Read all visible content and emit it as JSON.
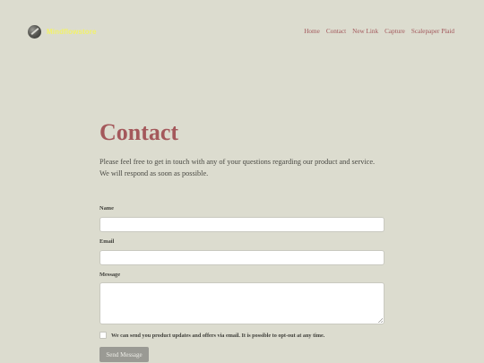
{
  "header": {
    "logo_text": "Mindflowstore",
    "nav": [
      {
        "label": "Home"
      },
      {
        "label": "Contact"
      },
      {
        "label": "New Link"
      },
      {
        "label": "Capture"
      },
      {
        "label": "Scalepaper Plaid"
      }
    ]
  },
  "main": {
    "title": "Contact",
    "intro_line1": "Please feel free to get in touch with any of your questions regarding our product and service.",
    "intro_line2": "We will respond as soon as possible."
  },
  "form": {
    "name_label": "Name",
    "name_value": "",
    "email_label": "Email",
    "email_value": "",
    "message_label": "Message",
    "message_value": "",
    "consent_label": "We can send you product updates and offers via email. It is possible to opt-out at any time.",
    "consent_checked": false,
    "submit_label": "Send Message"
  },
  "colors": {
    "background": "#dcdccf",
    "accent": "#a4585b",
    "logo": "#f2f26a",
    "button": "#9a9a94"
  }
}
